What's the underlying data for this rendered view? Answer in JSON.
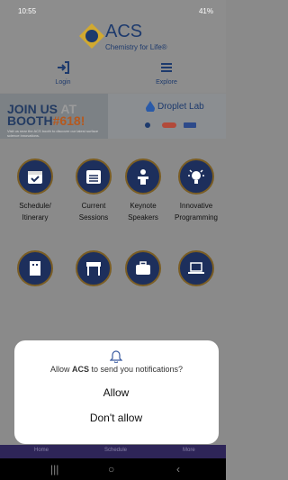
{
  "status_bar": {
    "time": "10:55",
    "battery": "41%"
  },
  "header": {
    "logo_name": "ACS",
    "logo_tagline": "Chemistry for Life®",
    "login_label": "Login",
    "explore_label": "Explore"
  },
  "banner": {
    "join_line1": "JOIN US",
    "join_at": "AT",
    "join_line2": "BOOTH",
    "booth_number": "#618!",
    "small_text": "Visit us near the ACS booth to discover our latest surface science innovations.",
    "sponsor_name": "Droplet Lab"
  },
  "tiles": [
    {
      "label": "Schedule/ Itinerary",
      "icon": "calendar-check-icon"
    },
    {
      "label": "Current Sessions",
      "icon": "calendar-list-icon"
    },
    {
      "label": "Keynote Speakers",
      "icon": "speaker-podium-icon"
    },
    {
      "label": "Innovative Programming",
      "icon": "lightbulb-icon"
    },
    {
      "label": "",
      "icon": "building-icon"
    },
    {
      "label": "",
      "icon": "expo-booth-icon"
    },
    {
      "label": "",
      "icon": "briefcase-icon"
    },
    {
      "label": "",
      "icon": "laptop-icon"
    }
  ],
  "dialog": {
    "message_prefix": "Allow ",
    "app_name": "ACS",
    "message_suffix": " to send you notifications?",
    "allow_label": "Allow",
    "deny_label": "Don't allow"
  },
  "tabbar": {
    "home": "Home",
    "schedule": "Schedule",
    "more": "More"
  },
  "colors": {
    "brand_navy": "#1d2f5c",
    "gold": "#7a5d24",
    "orange": "#b5591f",
    "tabbar": "#2e2558"
  }
}
